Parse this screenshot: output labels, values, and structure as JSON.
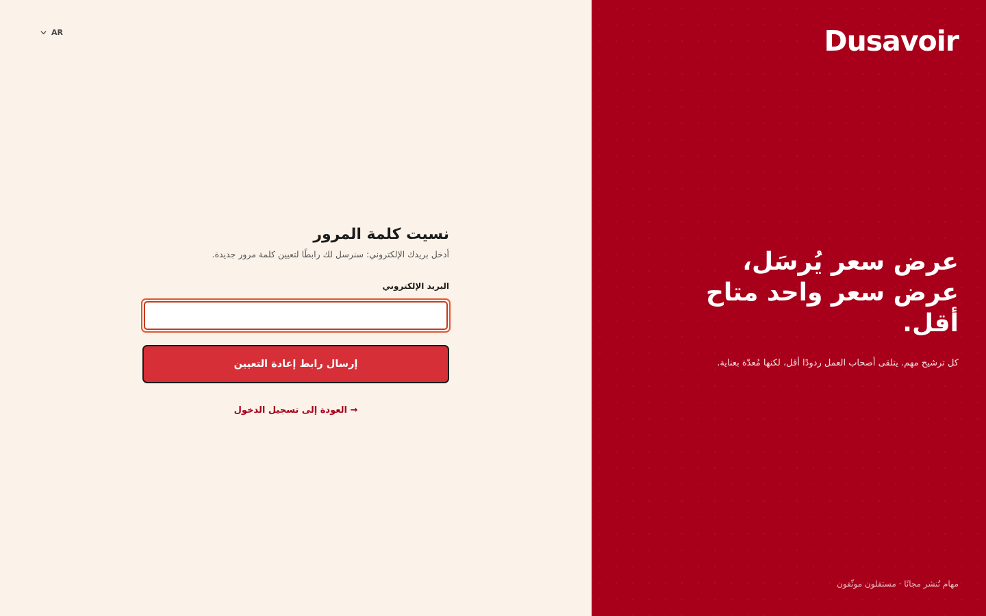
{
  "lang": {
    "label": "AR"
  },
  "form": {
    "title": "نسيت كلمة المرور",
    "subtitle": "أدخل بريدك الإلكتروني: سنرسل لك رابطًا لتعيين كلمة مرور جديدة.",
    "email_label": "البريد الإلكتروني",
    "email_value": "",
    "email_placeholder": "",
    "submit_label": "إرسال رابط إعادة التعيين",
    "back_link": "→ العودة إلى تسجيل الدخول"
  },
  "brand": {
    "logo": "Dusavoir",
    "hero_title": "عرض سعر يُرسَل، عرض سعر واحد متاح أقل.",
    "hero_text": "كل ترشيح مهم. يتلقى أصحاب العمل ردودًا أقل، لكنها مُعدّة بعناية.",
    "footer": "مهام تُنشر مجانًا · مستقلون موثّقون"
  },
  "colors": {
    "panel": "#a8001a",
    "background": "#fbf3ea",
    "button": "#d62f38",
    "input_focus_ring": "#e2562d"
  },
  "icons": {
    "lang_caret": "chevron-down-icon"
  }
}
